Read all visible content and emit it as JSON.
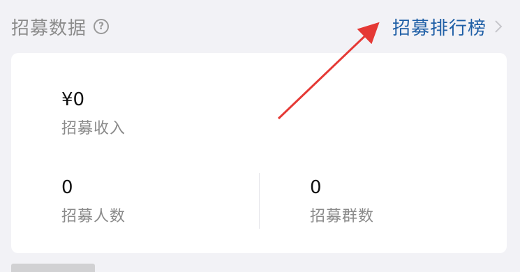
{
  "header": {
    "title": "招募数据",
    "help_icon": "question-circle",
    "rank_link_label": "招募排行榜",
    "rank_link_icon": "chevron-right"
  },
  "stats": {
    "income": {
      "value": "¥0",
      "label": "招募收入"
    },
    "people": {
      "value": "0",
      "label": "招募人数"
    },
    "groups": {
      "value": "0",
      "label": "招募群数"
    }
  },
  "colors": {
    "page_bg": "#f2f2f6",
    "card_bg": "#ffffff",
    "link": "#1f5fa6",
    "muted_text": "#8a8a8a",
    "annotation_arrow": "#e53935"
  }
}
